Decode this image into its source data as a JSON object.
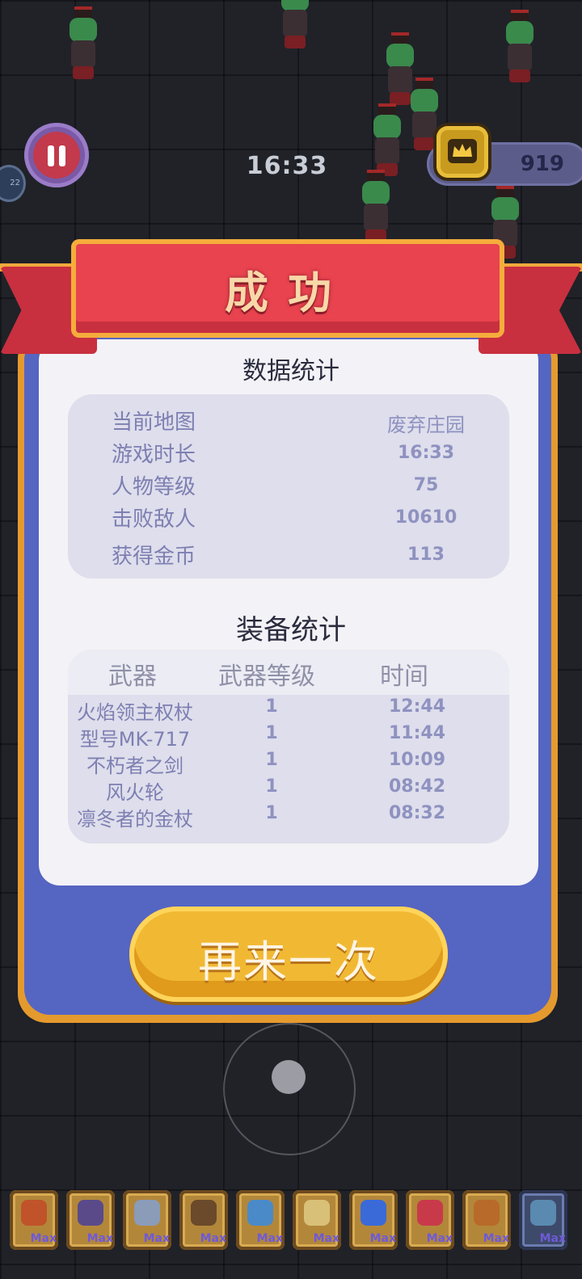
{
  "hud": {
    "timer": "16:33",
    "coins": "919",
    "level_bubble": "22"
  },
  "dialog": {
    "title": "成功",
    "stats_title": "数据统计",
    "stats": [
      {
        "label": "当前地图",
        "value": "废弃庄园"
      },
      {
        "label": "游戏时长",
        "value": "16:33"
      },
      {
        "label": "人物等级",
        "value": "75"
      },
      {
        "label": "击败敌人",
        "value": "10610"
      },
      {
        "label": "获得金币",
        "value": "113"
      }
    ],
    "equip_title": "装备统计",
    "equip_headers": {
      "weapon": "武器",
      "level": "武器等级",
      "time": "时间"
    },
    "equipment": [
      {
        "name": "火焰领主权杖",
        "level": "1",
        "time": "12:44"
      },
      {
        "name": "型号MK-717",
        "level": "1",
        "time": "11:44"
      },
      {
        "name": "不朽者之剑",
        "level": "1",
        "time": "10:09"
      },
      {
        "name": "风火轮",
        "level": "1",
        "time": "08:42"
      },
      {
        "name": "凛冬者的金杖",
        "level": "1",
        "time": "08:32"
      }
    ],
    "retry_label": "再来一次"
  },
  "inventory": {
    "slots": [
      {
        "icon": "flame-scepter-icon",
        "label": "Max",
        "color": "#c0532a"
      },
      {
        "icon": "blaster-gun-icon",
        "label": "Max",
        "color": "#5a4a8a"
      },
      {
        "icon": "sword-icon",
        "label": "Max",
        "color": "#8a9cb8"
      },
      {
        "icon": "spiked-shield-icon",
        "label": "Max",
        "color": "#6a4a2a"
      },
      {
        "icon": "ice-staff-icon",
        "label": "Max",
        "color": "#4a8ac8"
      },
      {
        "icon": "scroll-icon",
        "label": "Max",
        "color": "#d8c078"
      },
      {
        "icon": "blue-mace-icon",
        "label": "Max",
        "color": "#3a6ad8"
      },
      {
        "icon": "fire-wheel-icon",
        "label": "Max",
        "color": "#c83a4a"
      },
      {
        "icon": "armor-icon",
        "label": "Max",
        "color": "#b86a2a"
      },
      {
        "icon": "boots-icon",
        "label": "Max",
        "color": "#5a8ab0"
      }
    ]
  }
}
